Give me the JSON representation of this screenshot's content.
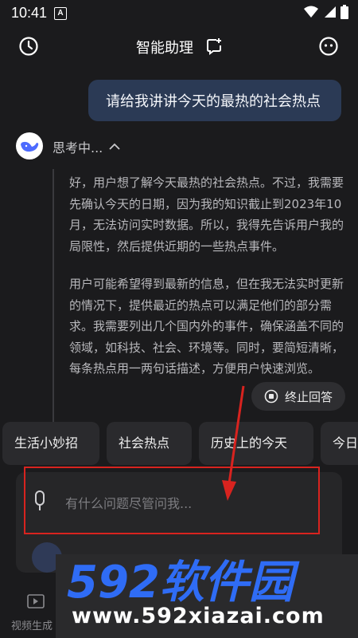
{
  "status_bar": {
    "time": "10:41",
    "notification_letter": "A"
  },
  "header": {
    "title": "智能助理"
  },
  "conversation": {
    "user_message": "请给我讲讲今天的最热的社会热点",
    "thinking_label": "思考中...",
    "thinking_paragraphs": [
      "好，用户想了解今天最热的社会热点。不过，我需要先确认今天的日期，因为我的知识截止到2023年10月，无法访问实时数据。所以，我得先告诉用户我的局限性，然后提供近期的一些热点事件。",
      "用户可能希望得到最新的信息，但在我无法实时更新的情况下，提供最近的热点可以满足他们的部分需求。我需要列出几个国内外的事件，确保涵盖不同的领域，如科技、社会、环境等。同时，要简短清晰，每条热点用一两句话描述，方便用户快速浏览。"
    ],
    "stop_label": "终止回答"
  },
  "quick_chips": [
    "生活小妙招",
    "社会热点",
    "历史上的今天",
    "今日"
  ],
  "input": {
    "placeholder": "有什么问题尽管问我..."
  },
  "bottom_nav": {
    "item_label": "视频生成"
  },
  "watermark": {
    "logo_text": "592软件园",
    "url": "www.592xiazai.com"
  },
  "colors": {
    "background": "#1b1b1d",
    "user_bubble": "#2b3a55",
    "annotation": "#d8231f",
    "watermark_blue": "#2f6cf5"
  }
}
